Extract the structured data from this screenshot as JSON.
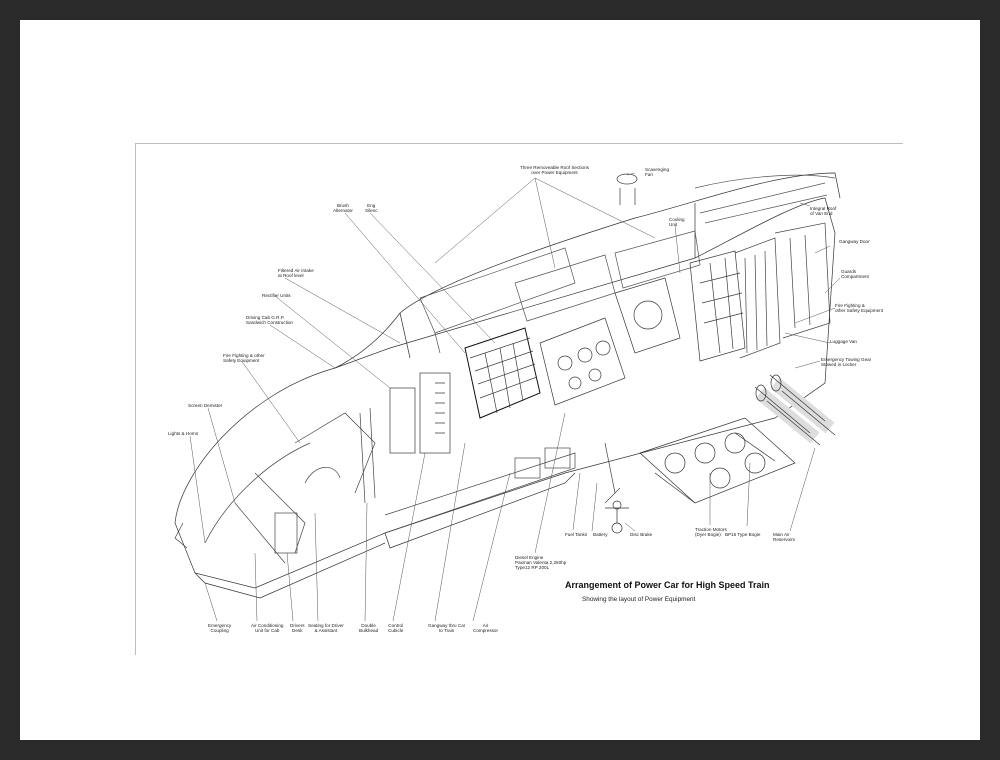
{
  "caption": {
    "title": "Arrangement of Power Car for High Speed Train",
    "subtitle": "Showing the layout of Power Equipment"
  },
  "labels": {
    "roof_sections": "Three Removeable Roof Sections\nover Power Equipment",
    "scavenging_fan": "Scavenging\nFan",
    "integral_roof": "Integral Roof\nof Van End",
    "cooling_unit": "Cooling\nUnit",
    "gangway_door": "Gangway Door",
    "guards_compartment": "Guards\nCompartment",
    "fire_fighting_right": "Fire Fighting &\nother Safety Equipment",
    "luggage_van": "Luggage Van",
    "emergency_towing_gear": "Emergency Towing Gear\nStowed in Locker",
    "brush_alternator": "Brush\nAlternator",
    "eng_silencer": "Eng\nSilenc",
    "filtered_air_intake": "Filtered Air Intake\nat Roof level",
    "rectifier_units": "Rectifier Units",
    "driving_cab": "Driving Cab G.R.P.\nSandwich Construction",
    "fire_fighting_left": "Fire Fighting & other\nSafety Equipment",
    "screen_demister": "Screen Demister",
    "lights_horns": "Lights & Horns",
    "diesel_engine": "Diesel Engine\nPaxman Valenta 2,250hp\nType12 RP 200L",
    "fuel_tanks": "Fuel Tanks",
    "battery": "Battery",
    "disc_brake": "Disc Brake",
    "traction_motors": "Traction Motors\n(Dyer Bogie)",
    "bp16_bogie": "BP16 Type Bogie",
    "main_air_reservoirs": "Main Air\nReservoirs",
    "emergency_coupling": "Emergency\nCoupling",
    "air_conditioning": "Air Conditioning\nUnit for Cab",
    "drivers_desk": "Drivers\nDesk",
    "seating": "Seating for Driver\n& Assistant",
    "double_bulkhead": "Double\nBulkhead",
    "control_cubicle": "Control\nCubicle",
    "gangway_car": "Gangway thru Car\nto Train",
    "air_compressor": "Air\nCompressor"
  }
}
